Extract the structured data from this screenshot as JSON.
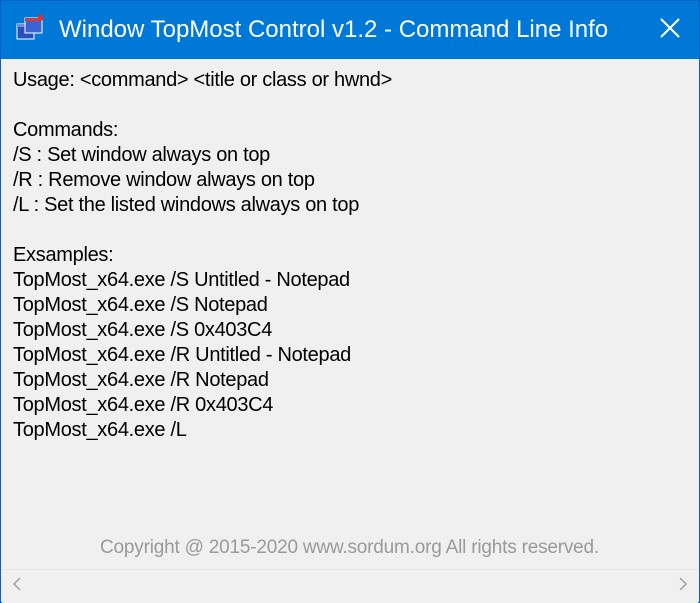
{
  "window": {
    "title": "Window TopMost Control v1.2 - Command Line Info",
    "close_icon": "close-icon",
    "app_icon": "app-windows-icon"
  },
  "colors": {
    "titlebar": "#0078d7",
    "background": "#f0f0f0",
    "text": "#000000",
    "copyright": "#9a9a9a"
  },
  "content": {
    "lines": [
      "Usage: <command> <title or class or hwnd>",
      "",
      "Commands:",
      "/S : Set window always on top",
      "/R : Remove window always on top",
      "/L : Set the listed windows always on top",
      "",
      "Exsamples:",
      "TopMost_x64.exe /S Untitled - Notepad",
      "TopMost_x64.exe /S Notepad",
      "TopMost_x64.exe /S 0x403C4",
      "TopMost_x64.exe /R Untitled - Notepad",
      "TopMost_x64.exe /R Notepad",
      "TopMost_x64.exe /R 0x403C4",
      "TopMost_x64.exe /L"
    ],
    "copyright": "Copyright @ 2015-2020 www.sordum.org All rights reserved."
  },
  "scrollbar": {
    "left_icon": "chevron-left-icon",
    "right_icon": "chevron-right-icon"
  }
}
